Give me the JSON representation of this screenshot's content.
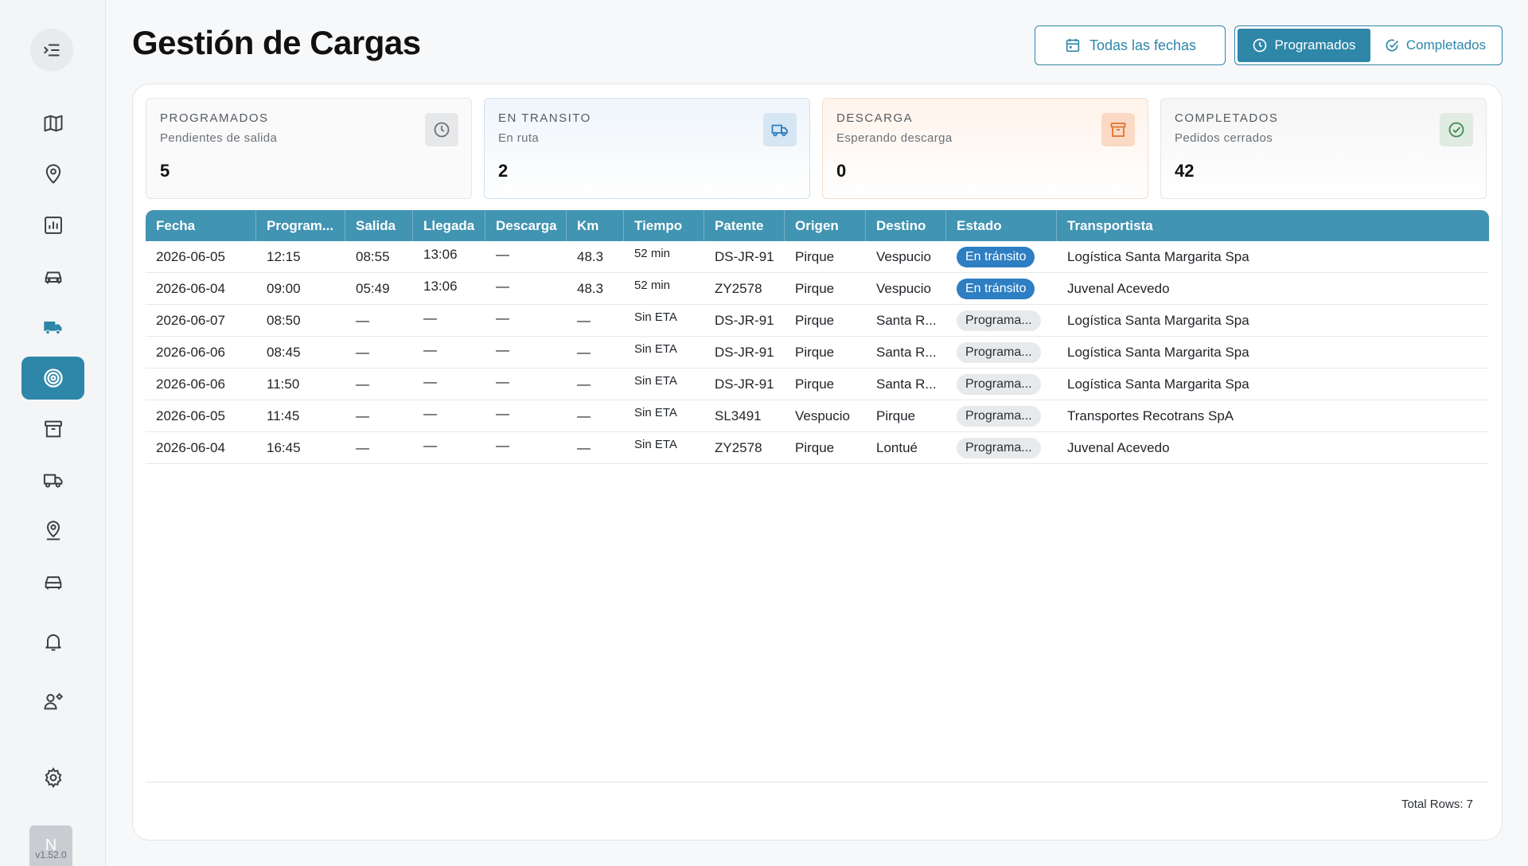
{
  "sidebar": {
    "toggle_icon": "menu-collapse-icon",
    "items": [
      {
        "name": "map-icon"
      },
      {
        "name": "map-pin-icon"
      },
      {
        "name": "chart-icon"
      },
      {
        "name": "car-icon"
      },
      {
        "name": "truck-filled-icon"
      },
      {
        "name": "target-icon",
        "active": true
      },
      {
        "name": "archive-icon"
      },
      {
        "name": "truck-icon"
      },
      {
        "name": "location-icon"
      },
      {
        "name": "car-front-icon"
      },
      {
        "name": "bell-icon"
      },
      {
        "name": "user-settings-icon"
      },
      {
        "name": "gear-icon"
      }
    ],
    "avatar_initial": "N",
    "version": "v1.52.0"
  },
  "header": {
    "title": "Gestión de Cargas",
    "dates_button": "Todas las fechas",
    "segment": {
      "programados": "Programados",
      "completados": "Completados"
    }
  },
  "kpis": [
    {
      "title": "PROGRAMADOS",
      "subtitle": "Pendientes de salida",
      "value": "5",
      "icon": "clock-icon",
      "color": "#6b7178"
    },
    {
      "title": "EN TRANSITO",
      "subtitle": "En ruta",
      "value": "2",
      "icon": "truck-icon",
      "color": "#2d7ec2"
    },
    {
      "title": "DESCARGA",
      "subtitle": "Esperando descarga",
      "value": "0",
      "icon": "archive-icon",
      "color": "#e0742e"
    },
    {
      "title": "COMPLETADOS",
      "subtitle": "Pedidos cerrados",
      "value": "42",
      "icon": "check-circle-icon",
      "color": "#3d8a4f"
    }
  ],
  "table": {
    "columns": [
      "Fecha",
      "Program...",
      "Salida",
      "Llegada",
      "Descarga",
      "Km",
      "Tiempo",
      "Patente",
      "Origen",
      "Destino",
      "Estado",
      "Transportista"
    ],
    "rows": [
      [
        "2026-06-05",
        "12:15",
        "08:55",
        "13:06",
        "—",
        "48.3",
        "52 min",
        "DS-JR-91",
        "Pirque",
        "Vespucio",
        "En tránsito",
        "Logística Santa Margarita Spa"
      ],
      [
        "2026-06-04",
        "09:00",
        "05:49",
        "13:06",
        "—",
        "48.3",
        "52 min",
        "ZY2578",
        "Pirque",
        "Vespucio",
        "En tránsito",
        "Juvenal Acevedo"
      ],
      [
        "2026-06-07",
        "08:50",
        "—",
        "—",
        "—",
        "—",
        "Sin ETA",
        "DS-JR-91",
        "Pirque",
        "Santa R...",
        "Programa...",
        "Logística Santa Margarita Spa"
      ],
      [
        "2026-06-06",
        "08:45",
        "—",
        "—",
        "—",
        "—",
        "Sin ETA",
        "DS-JR-91",
        "Pirque",
        "Santa R...",
        "Programa...",
        "Logística Santa Margarita Spa"
      ],
      [
        "2026-06-06",
        "11:50",
        "—",
        "—",
        "—",
        "—",
        "Sin ETA",
        "DS-JR-91",
        "Pirque",
        "Santa R...",
        "Programa...",
        "Logística Santa Margarita Spa"
      ],
      [
        "2026-06-05",
        "11:45",
        "—",
        "—",
        "—",
        "—",
        "Sin ETA",
        "SL3491",
        "Vespucio",
        "Pirque",
        "Programa...",
        "Transportes Recotrans SpA"
      ],
      [
        "2026-06-04",
        "16:45",
        "—",
        "—",
        "—",
        "—",
        "Sin ETA",
        "ZY2578",
        "Pirque",
        "Lontué",
        "Programa...",
        "Juvenal Acevedo"
      ]
    ],
    "total_label": "Total Rows: 7"
  },
  "colors": {
    "accent": "#2e86a8",
    "header_bg": "#4194b2",
    "badge_transit": "#2d7ec2",
    "badge_programado": "#e8e9eb"
  }
}
